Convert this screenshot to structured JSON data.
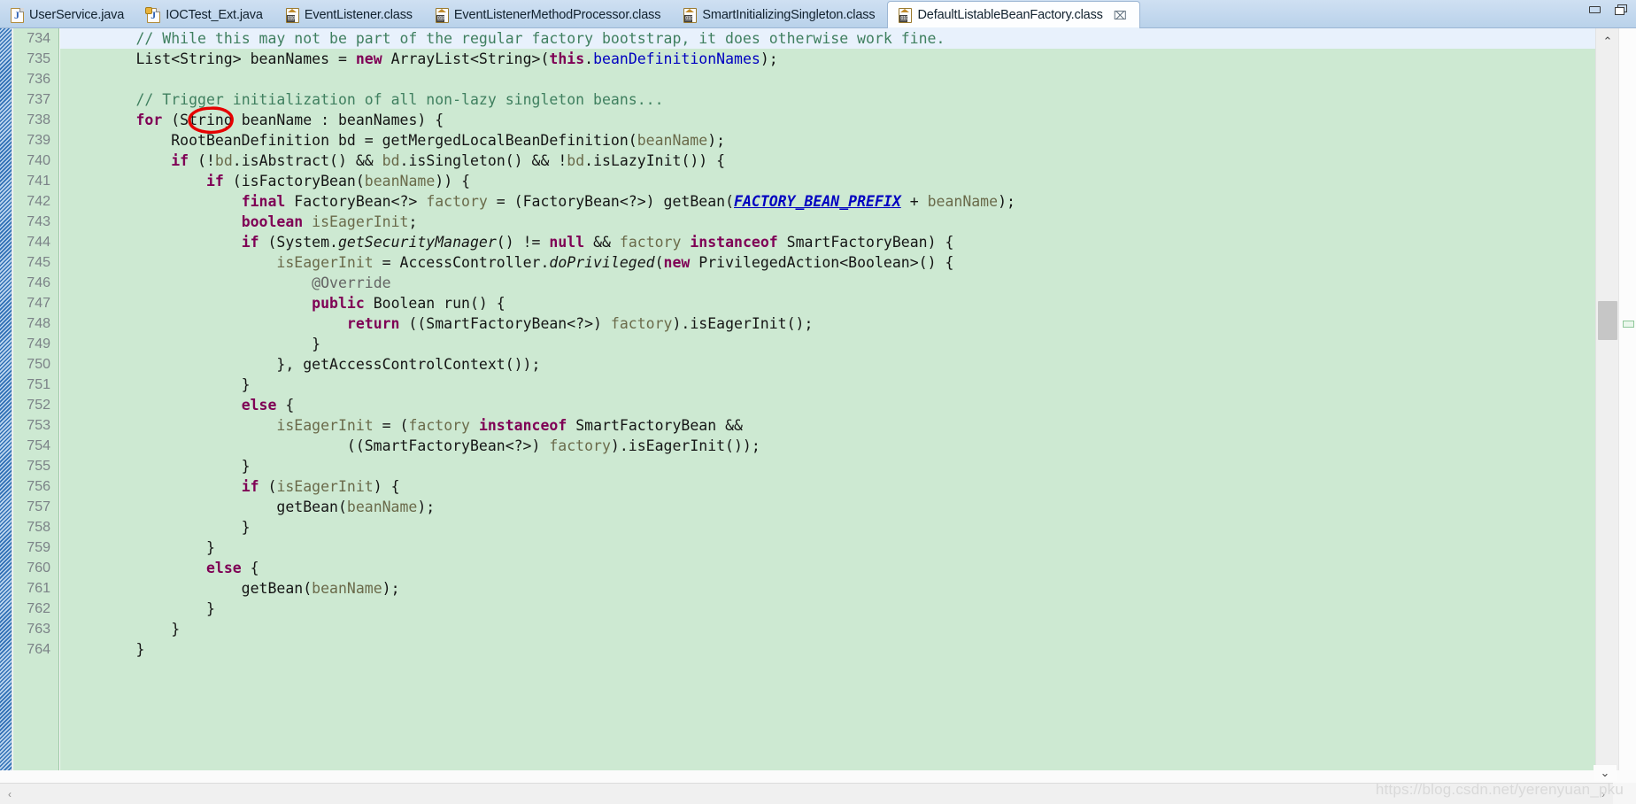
{
  "window": {
    "minimize_label": "minimize",
    "restore_label": "restore"
  },
  "tabs": [
    {
      "label": "UserService.java",
      "icon": "java-file-icon",
      "active": false,
      "closable": false
    },
    {
      "label": "IOCTest_Ext.java",
      "icon": "java-file-locked-icon",
      "active": false,
      "closable": false
    },
    {
      "label": "EventListener.class",
      "icon": "class-file-icon",
      "active": false,
      "closable": false
    },
    {
      "label": "EventListenerMethodProcessor.class",
      "icon": "class-file-icon",
      "active": false,
      "closable": false
    },
    {
      "label": "SmartInitializingSingleton.class",
      "icon": "class-file-icon",
      "active": false,
      "closable": false
    },
    {
      "label": "DefaultListableBeanFactory.class",
      "icon": "class-file-icon",
      "active": true,
      "closable": true,
      "close_glyph": "⌧"
    }
  ],
  "editor": {
    "first_line_number": 734,
    "highlighted_line": 734,
    "annotation": {
      "shape": "ellipse",
      "color": "#e60000",
      "targets_token": "for",
      "on_line": 738
    },
    "lines": [
      {
        "n": 734,
        "tokens": [
          {
            "t": "        ",
            "c": "pln"
          },
          {
            "t": "// While this may not be part of the regular factory bootstrap, it does otherwise work fine.",
            "c": "cmt"
          }
        ]
      },
      {
        "n": 735,
        "tokens": [
          {
            "t": "        List<String> beanNames = ",
            "c": "pln"
          },
          {
            "t": "new",
            "c": "kw"
          },
          {
            "t": " ArrayList<String>(",
            "c": "pln"
          },
          {
            "t": "this",
            "c": "kw"
          },
          {
            "t": ".",
            "c": "pln"
          },
          {
            "t": "beanDefinitionNames",
            "c": "fld"
          },
          {
            "t": ");",
            "c": "pln"
          }
        ]
      },
      {
        "n": 736,
        "tokens": [
          {
            "t": "",
            "c": "pln"
          }
        ]
      },
      {
        "n": 737,
        "tokens": [
          {
            "t": "        ",
            "c": "pln"
          },
          {
            "t": "// Trigger initialization of all non-lazy singleton beans...",
            "c": "cmt"
          }
        ]
      },
      {
        "n": 738,
        "tokens": [
          {
            "t": "        ",
            "c": "pln"
          },
          {
            "t": "for",
            "c": "kw"
          },
          {
            "t": " (String beanName : beanNames) {",
            "c": "pln"
          }
        ]
      },
      {
        "n": 739,
        "tokens": [
          {
            "t": "            RootBeanDefinition bd = getMergedLocalBeanDefinition(",
            "c": "pln"
          },
          {
            "t": "beanName",
            "c": "par"
          },
          {
            "t": ");",
            "c": "pln"
          }
        ]
      },
      {
        "n": 740,
        "tokens": [
          {
            "t": "            ",
            "c": "pln"
          },
          {
            "t": "if",
            "c": "kw"
          },
          {
            "t": " (!",
            "c": "pln"
          },
          {
            "t": "bd",
            "c": "par"
          },
          {
            "t": ".isAbstract() && ",
            "c": "pln"
          },
          {
            "t": "bd",
            "c": "par"
          },
          {
            "t": ".isSingleton() && !",
            "c": "pln"
          },
          {
            "t": "bd",
            "c": "par"
          },
          {
            "t": ".isLazyInit()) {",
            "c": "pln"
          }
        ]
      },
      {
        "n": 741,
        "tokens": [
          {
            "t": "                ",
            "c": "pln"
          },
          {
            "t": "if",
            "c": "kw"
          },
          {
            "t": " (isFactoryBean(",
            "c": "pln"
          },
          {
            "t": "beanName",
            "c": "par"
          },
          {
            "t": ")) {",
            "c": "pln"
          }
        ]
      },
      {
        "n": 742,
        "tokens": [
          {
            "t": "                    ",
            "c": "pln"
          },
          {
            "t": "final",
            "c": "kw"
          },
          {
            "t": " FactoryBean<?> ",
            "c": "pln"
          },
          {
            "t": "factory",
            "c": "par"
          },
          {
            "t": " = (FactoryBean<?>) getBean(",
            "c": "pln"
          },
          {
            "t": "FACTORY_BEAN_PREFIX",
            "c": "sfld"
          },
          {
            "t": " + ",
            "c": "pln"
          },
          {
            "t": "beanName",
            "c": "par"
          },
          {
            "t": ");",
            "c": "pln"
          }
        ]
      },
      {
        "n": 743,
        "tokens": [
          {
            "t": "                    ",
            "c": "pln"
          },
          {
            "t": "boolean",
            "c": "kw"
          },
          {
            "t": " ",
            "c": "pln"
          },
          {
            "t": "isEagerInit",
            "c": "par"
          },
          {
            "t": ";",
            "c": "pln"
          }
        ]
      },
      {
        "n": 744,
        "tokens": [
          {
            "t": "                    ",
            "c": "pln"
          },
          {
            "t": "if",
            "c": "kw"
          },
          {
            "t": " (System.",
            "c": "pln"
          },
          {
            "t": "getSecurityManager",
            "c": "smth"
          },
          {
            "t": "() != ",
            "c": "pln"
          },
          {
            "t": "null",
            "c": "kw"
          },
          {
            "t": " && ",
            "c": "pln"
          },
          {
            "t": "factory",
            "c": "par"
          },
          {
            "t": " ",
            "c": "pln"
          },
          {
            "t": "instanceof",
            "c": "kw"
          },
          {
            "t": " SmartFactoryBean) {",
            "c": "pln"
          }
        ]
      },
      {
        "n": 745,
        "tokens": [
          {
            "t": "                        ",
            "c": "pln"
          },
          {
            "t": "isEagerInit",
            "c": "par"
          },
          {
            "t": " = AccessController.",
            "c": "pln"
          },
          {
            "t": "doPrivileged",
            "c": "smth"
          },
          {
            "t": "(",
            "c": "pln"
          },
          {
            "t": "new",
            "c": "kw"
          },
          {
            "t": " PrivilegedAction<Boolean>() {",
            "c": "pln"
          }
        ]
      },
      {
        "n": 746,
        "tokens": [
          {
            "t": "                            ",
            "c": "pln"
          },
          {
            "t": "@Override",
            "c": "ann"
          }
        ]
      },
      {
        "n": 747,
        "tokens": [
          {
            "t": "                            ",
            "c": "pln"
          },
          {
            "t": "public",
            "c": "kw"
          },
          {
            "t": " Boolean run() {",
            "c": "pln"
          }
        ]
      },
      {
        "n": 748,
        "tokens": [
          {
            "t": "                                ",
            "c": "pln"
          },
          {
            "t": "return",
            "c": "kw"
          },
          {
            "t": " ((SmartFactoryBean<?>) ",
            "c": "pln"
          },
          {
            "t": "factory",
            "c": "par"
          },
          {
            "t": ").isEagerInit();",
            "c": "pln"
          }
        ]
      },
      {
        "n": 749,
        "tokens": [
          {
            "t": "                            }",
            "c": "pln"
          }
        ]
      },
      {
        "n": 750,
        "tokens": [
          {
            "t": "                        }, getAccessControlContext());",
            "c": "pln"
          }
        ]
      },
      {
        "n": 751,
        "tokens": [
          {
            "t": "                    }",
            "c": "pln"
          }
        ]
      },
      {
        "n": 752,
        "tokens": [
          {
            "t": "                    ",
            "c": "pln"
          },
          {
            "t": "else",
            "c": "kw"
          },
          {
            "t": " {",
            "c": "pln"
          }
        ]
      },
      {
        "n": 753,
        "tokens": [
          {
            "t": "                        ",
            "c": "pln"
          },
          {
            "t": "isEagerInit",
            "c": "par"
          },
          {
            "t": " = (",
            "c": "pln"
          },
          {
            "t": "factory",
            "c": "par"
          },
          {
            "t": " ",
            "c": "pln"
          },
          {
            "t": "instanceof",
            "c": "kw"
          },
          {
            "t": " SmartFactoryBean &&",
            "c": "pln"
          }
        ]
      },
      {
        "n": 754,
        "tokens": [
          {
            "t": "                                ((SmartFactoryBean<?>) ",
            "c": "pln"
          },
          {
            "t": "factory",
            "c": "par"
          },
          {
            "t": ").isEagerInit());",
            "c": "pln"
          }
        ]
      },
      {
        "n": 755,
        "tokens": [
          {
            "t": "                    }",
            "c": "pln"
          }
        ]
      },
      {
        "n": 756,
        "tokens": [
          {
            "t": "                    ",
            "c": "pln"
          },
          {
            "t": "if",
            "c": "kw"
          },
          {
            "t": " (",
            "c": "pln"
          },
          {
            "t": "isEagerInit",
            "c": "par"
          },
          {
            "t": ") {",
            "c": "pln"
          }
        ]
      },
      {
        "n": 757,
        "tokens": [
          {
            "t": "                        getBean(",
            "c": "pln"
          },
          {
            "t": "beanName",
            "c": "par"
          },
          {
            "t": ");",
            "c": "pln"
          }
        ]
      },
      {
        "n": 758,
        "tokens": [
          {
            "t": "                    }",
            "c": "pln"
          }
        ]
      },
      {
        "n": 759,
        "tokens": [
          {
            "t": "                }",
            "c": "pln"
          }
        ]
      },
      {
        "n": 760,
        "tokens": [
          {
            "t": "                ",
            "c": "pln"
          },
          {
            "t": "else",
            "c": "kw"
          },
          {
            "t": " {",
            "c": "pln"
          }
        ]
      },
      {
        "n": 761,
        "tokens": [
          {
            "t": "                    getBean(",
            "c": "pln"
          },
          {
            "t": "beanName",
            "c": "par"
          },
          {
            "t": ");",
            "c": "pln"
          }
        ]
      },
      {
        "n": 762,
        "tokens": [
          {
            "t": "                }",
            "c": "pln"
          }
        ]
      },
      {
        "n": 763,
        "tokens": [
          {
            "t": "            }",
            "c": "pln"
          }
        ]
      },
      {
        "n": 764,
        "tokens": [
          {
            "t": "        }",
            "c": "pln"
          }
        ]
      }
    ]
  },
  "scrollbars": {
    "vertical_up_glyph": "⌃",
    "vertical_down_glyph": "⌄",
    "horizontal_left_glyph": "‹",
    "horizontal_right_glyph": "›"
  },
  "watermark": "https://blog.csdn.net/yerenyuan_pku",
  "colors": {
    "code_background": "#cde9d2",
    "highlight_line": "#e8f1fc",
    "tab_bar": "#c3d8ee",
    "annotation_red": "#e60000",
    "keyword": "#7f0055",
    "comment": "#3f7f5f",
    "parameter": "#6a6a4a",
    "field": "#0000c0"
  }
}
